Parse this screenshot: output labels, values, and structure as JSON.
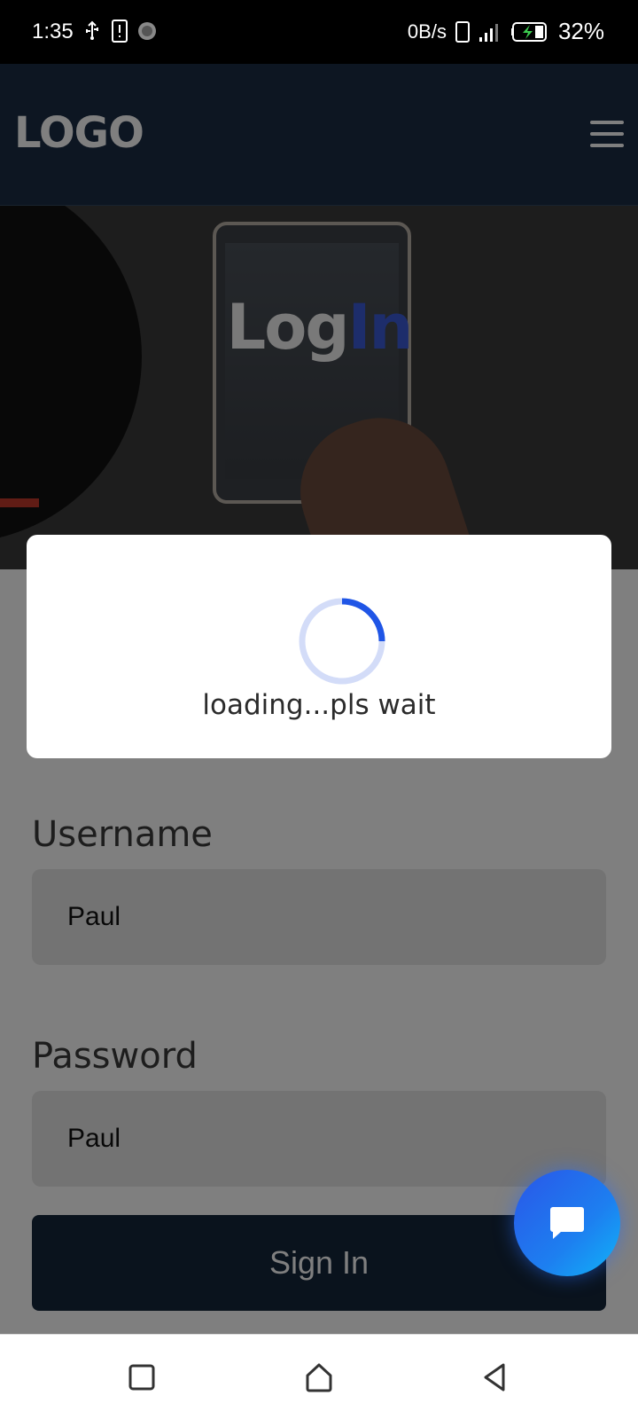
{
  "status_bar": {
    "time": "1:35",
    "net_speed": "0B/s",
    "battery_percent": "32%",
    "icons": [
      "usb-icon",
      "alert-icon",
      "sync-icon",
      "vibrate-icon",
      "signal-icon",
      "battery-charging-icon"
    ]
  },
  "header": {
    "logo": "LOGO",
    "menu_icon": "hamburger-menu-icon"
  },
  "hero": {
    "title_part1": "Log",
    "title_part2": "In",
    "accent_color": "#3a5ad6"
  },
  "form": {
    "username_label": "Username",
    "username_value": "Paul",
    "password_label": "Password",
    "password_value": "Paul",
    "signin_label": "Sign In"
  },
  "loading_dialog": {
    "text": "loading...pls wait",
    "spinner_color": "#1f55e6"
  },
  "chat_button": {
    "icon": "chat-bubble-icon"
  },
  "nav_bar": {
    "icons": [
      "recent-apps-icon",
      "home-icon",
      "back-icon"
    ]
  }
}
